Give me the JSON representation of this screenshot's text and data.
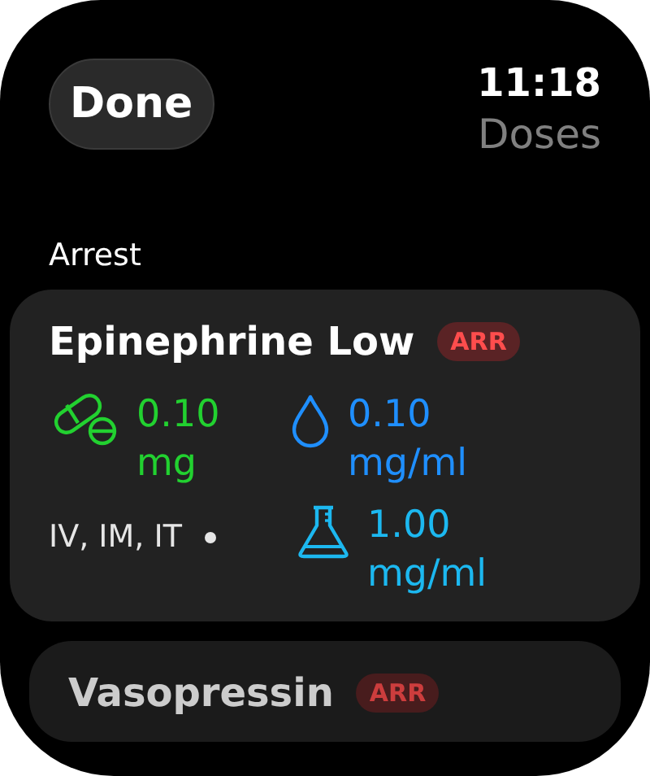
{
  "header": {
    "done_button": "Done",
    "time": "11:18",
    "title": "Doses"
  },
  "section": "Arrest",
  "cards": [
    {
      "title": "Epinephrine Low",
      "badge": "ARR",
      "routes": "IV, IM, IT",
      "doses": [
        {
          "kind": "pill",
          "text": "0.10 mg"
        },
        {
          "kind": "drop",
          "text": "0.10 mg/ml"
        },
        {
          "kind": "flask",
          "text": "1.00 mg/ml"
        }
      ]
    },
    {
      "title": "Vasopressin",
      "badge": "ARR"
    }
  ]
}
